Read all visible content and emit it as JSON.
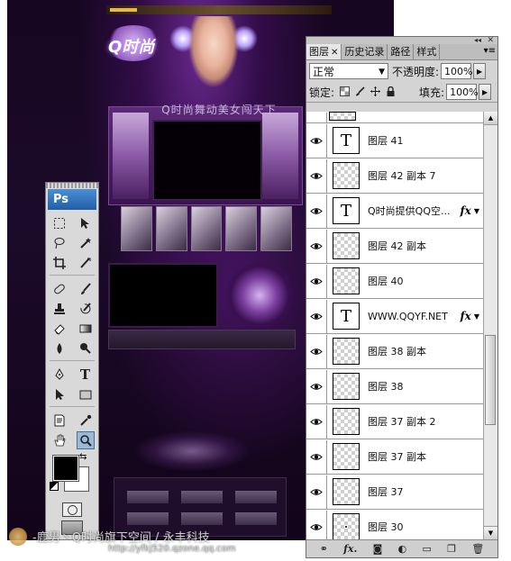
{
  "tools_panel": {
    "logo": "Ps",
    "rows": [
      [
        "marquee-tool",
        "move-tool"
      ],
      [
        "lasso-tool",
        "magic-wand-tool"
      ],
      [
        "crop-tool",
        "slice-tool"
      ],
      [
        "healing-brush-tool",
        "brush-tool"
      ],
      [
        "clone-stamp-tool",
        "history-brush-tool"
      ],
      [
        "eraser-tool",
        "gradient-tool"
      ],
      [
        "blur-tool",
        "dodge-tool"
      ],
      [
        "pen-tool",
        "type-tool"
      ],
      [
        "path-selection-tool",
        "rectangle-tool"
      ],
      [
        "notes-tool",
        "eyedropper-tool"
      ],
      [
        "hand-tool",
        "zoom-tool"
      ]
    ],
    "glyphs": {
      "type_tool": "T"
    },
    "foreground_color": "#000000",
    "background_color": "#ffffff",
    "selected_tool": "zoom-tool"
  },
  "layers_panel": {
    "tabs": [
      {
        "label": "图层",
        "closable": true
      },
      {
        "label": "历史记录"
      },
      {
        "label": "路径"
      },
      {
        "label": "样式"
      }
    ],
    "blend_mode": "正常",
    "opacity_label": "不透明度:",
    "opacity_value": "100%",
    "lock_label": "锁定:",
    "fill_label": "填充:",
    "fill_value": "100%",
    "layers": [
      {
        "name": "",
        "type": "partial"
      },
      {
        "name": "图层 41",
        "type": "text"
      },
      {
        "name": "图层 42 副本 7",
        "type": "raster"
      },
      {
        "name": "Q时尚提供QQ空...",
        "type": "text",
        "fx": true
      },
      {
        "name": "图层 42 副本",
        "type": "raster"
      },
      {
        "name": "图层 40",
        "type": "raster"
      },
      {
        "name": "WWW.QQYF.NET",
        "type": "text",
        "fx": true
      },
      {
        "name": "图层 38 副本",
        "type": "raster"
      },
      {
        "name": "图层 38",
        "type": "raster"
      },
      {
        "name": "图层 37 副本 2",
        "type": "raster"
      },
      {
        "name": "图层 37 副本",
        "type": "raster"
      },
      {
        "name": "图层 37",
        "type": "raster"
      },
      {
        "name": "图层 30",
        "type": "raster"
      }
    ],
    "text_thumb_glyph": "T",
    "fx_label": "fx",
    "bottom_fx_label": "fx."
  },
  "canvas": {
    "logo_text": "Q时尚",
    "slogan": "Q时尚舞动美女闯天下"
  },
  "watermark": {
    "line1": "-鹿男丶Q时尚旗下空间 / 永丰科技",
    "line2": "http://yfkj520.qzone.qq.com"
  }
}
